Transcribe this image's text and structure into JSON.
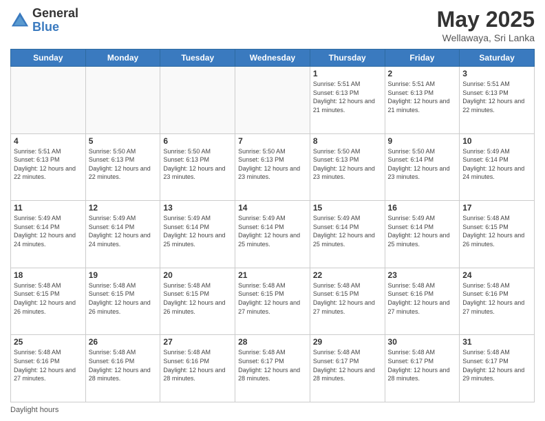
{
  "logo": {
    "general": "General",
    "blue": "Blue"
  },
  "header": {
    "title": "May 2025",
    "subtitle": "Wellawaya, Sri Lanka"
  },
  "days_of_week": [
    "Sunday",
    "Monday",
    "Tuesday",
    "Wednesday",
    "Thursday",
    "Friday",
    "Saturday"
  ],
  "weeks": [
    [
      {
        "day": "",
        "info": ""
      },
      {
        "day": "",
        "info": ""
      },
      {
        "day": "",
        "info": ""
      },
      {
        "day": "",
        "info": ""
      },
      {
        "day": "1",
        "info": "Sunrise: 5:51 AM\nSunset: 6:13 PM\nDaylight: 12 hours\nand 21 minutes."
      },
      {
        "day": "2",
        "info": "Sunrise: 5:51 AM\nSunset: 6:13 PM\nDaylight: 12 hours\nand 21 minutes."
      },
      {
        "day": "3",
        "info": "Sunrise: 5:51 AM\nSunset: 6:13 PM\nDaylight: 12 hours\nand 22 minutes."
      }
    ],
    [
      {
        "day": "4",
        "info": "Sunrise: 5:51 AM\nSunset: 6:13 PM\nDaylight: 12 hours\nand 22 minutes."
      },
      {
        "day": "5",
        "info": "Sunrise: 5:50 AM\nSunset: 6:13 PM\nDaylight: 12 hours\nand 22 minutes."
      },
      {
        "day": "6",
        "info": "Sunrise: 5:50 AM\nSunset: 6:13 PM\nDaylight: 12 hours\nand 23 minutes."
      },
      {
        "day": "7",
        "info": "Sunrise: 5:50 AM\nSunset: 6:13 PM\nDaylight: 12 hours\nand 23 minutes."
      },
      {
        "day": "8",
        "info": "Sunrise: 5:50 AM\nSunset: 6:13 PM\nDaylight: 12 hours\nand 23 minutes."
      },
      {
        "day": "9",
        "info": "Sunrise: 5:50 AM\nSunset: 6:14 PM\nDaylight: 12 hours\nand 23 minutes."
      },
      {
        "day": "10",
        "info": "Sunrise: 5:49 AM\nSunset: 6:14 PM\nDaylight: 12 hours\nand 24 minutes."
      }
    ],
    [
      {
        "day": "11",
        "info": "Sunrise: 5:49 AM\nSunset: 6:14 PM\nDaylight: 12 hours\nand 24 minutes."
      },
      {
        "day": "12",
        "info": "Sunrise: 5:49 AM\nSunset: 6:14 PM\nDaylight: 12 hours\nand 24 minutes."
      },
      {
        "day": "13",
        "info": "Sunrise: 5:49 AM\nSunset: 6:14 PM\nDaylight: 12 hours\nand 25 minutes."
      },
      {
        "day": "14",
        "info": "Sunrise: 5:49 AM\nSunset: 6:14 PM\nDaylight: 12 hours\nand 25 minutes."
      },
      {
        "day": "15",
        "info": "Sunrise: 5:49 AM\nSunset: 6:14 PM\nDaylight: 12 hours\nand 25 minutes."
      },
      {
        "day": "16",
        "info": "Sunrise: 5:49 AM\nSunset: 6:14 PM\nDaylight: 12 hours\nand 25 minutes."
      },
      {
        "day": "17",
        "info": "Sunrise: 5:48 AM\nSunset: 6:15 PM\nDaylight: 12 hours\nand 26 minutes."
      }
    ],
    [
      {
        "day": "18",
        "info": "Sunrise: 5:48 AM\nSunset: 6:15 PM\nDaylight: 12 hours\nand 26 minutes."
      },
      {
        "day": "19",
        "info": "Sunrise: 5:48 AM\nSunset: 6:15 PM\nDaylight: 12 hours\nand 26 minutes."
      },
      {
        "day": "20",
        "info": "Sunrise: 5:48 AM\nSunset: 6:15 PM\nDaylight: 12 hours\nand 26 minutes."
      },
      {
        "day": "21",
        "info": "Sunrise: 5:48 AM\nSunset: 6:15 PM\nDaylight: 12 hours\nand 27 minutes."
      },
      {
        "day": "22",
        "info": "Sunrise: 5:48 AM\nSunset: 6:15 PM\nDaylight: 12 hours\nand 27 minutes."
      },
      {
        "day": "23",
        "info": "Sunrise: 5:48 AM\nSunset: 6:16 PM\nDaylight: 12 hours\nand 27 minutes."
      },
      {
        "day": "24",
        "info": "Sunrise: 5:48 AM\nSunset: 6:16 PM\nDaylight: 12 hours\nand 27 minutes."
      }
    ],
    [
      {
        "day": "25",
        "info": "Sunrise: 5:48 AM\nSunset: 6:16 PM\nDaylight: 12 hours\nand 27 minutes."
      },
      {
        "day": "26",
        "info": "Sunrise: 5:48 AM\nSunset: 6:16 PM\nDaylight: 12 hours\nand 28 minutes."
      },
      {
        "day": "27",
        "info": "Sunrise: 5:48 AM\nSunset: 6:16 PM\nDaylight: 12 hours\nand 28 minutes."
      },
      {
        "day": "28",
        "info": "Sunrise: 5:48 AM\nSunset: 6:17 PM\nDaylight: 12 hours\nand 28 minutes."
      },
      {
        "day": "29",
        "info": "Sunrise: 5:48 AM\nSunset: 6:17 PM\nDaylight: 12 hours\nand 28 minutes."
      },
      {
        "day": "30",
        "info": "Sunrise: 5:48 AM\nSunset: 6:17 PM\nDaylight: 12 hours\nand 28 minutes."
      },
      {
        "day": "31",
        "info": "Sunrise: 5:48 AM\nSunset: 6:17 PM\nDaylight: 12 hours\nand 29 minutes."
      }
    ]
  ],
  "footer": {
    "daylight_label": "Daylight hours"
  }
}
